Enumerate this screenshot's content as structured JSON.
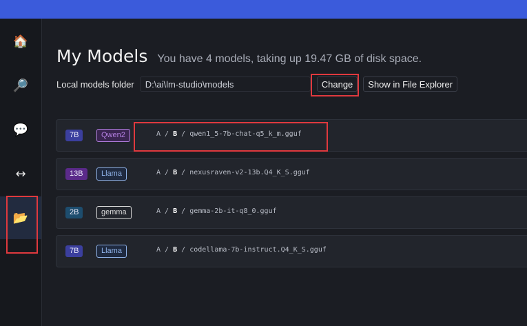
{
  "header": {
    "title": "My Models",
    "subtitle": "You have 4 models, taking up 19.47 GB of disk space."
  },
  "folder": {
    "label": "Local models folder",
    "path": "D:\\ai\\lm-studio\\models",
    "change_label": "Change",
    "explorer_label": "Show in File Explorer"
  },
  "sidebar": {
    "items": [
      {
        "name": "home",
        "icon": "🏠"
      },
      {
        "name": "search",
        "icon": "🔎"
      },
      {
        "name": "chat",
        "icon": "💬"
      },
      {
        "name": "server",
        "icon": "↔"
      },
      {
        "name": "my-models",
        "icon": "📂"
      }
    ]
  },
  "models": [
    {
      "size": "7B",
      "size_color": "#3b3f9e",
      "arch": "Qwen2",
      "arch_color": "#b37fe0",
      "arch_bg": "#3a2550",
      "author": "A",
      "repo": "B",
      "file": "qwen1_5-7b-chat-q5_k_m.gguf"
    },
    {
      "size": "13B",
      "size_color": "#5b2a8a",
      "arch": "Llama",
      "arch_color": "#8fb2e8",
      "arch_bg": "#1f2a40",
      "author": "A",
      "repo": "B",
      "file": "nexusraven-v2-13b.Q4_K_S.gguf"
    },
    {
      "size": "2B",
      "size_color": "#1d4d6e",
      "arch": "gemma",
      "arch_color": "#d8d8d8",
      "arch_bg": "#23262d",
      "author": "A",
      "repo": "B",
      "file": "gemma-2b-it-q8_0.gguf"
    },
    {
      "size": "7B",
      "size_color": "#3b3f9e",
      "arch": "Llama",
      "arch_color": "#8fb2e8",
      "arch_bg": "#1f2a40",
      "author": "A",
      "repo": "B",
      "file": "codellama-7b-instruct.Q4_K_S.gguf"
    }
  ],
  "colors": {
    "accent_bar": "#3b5bdb",
    "highlight": "#e0393e"
  }
}
